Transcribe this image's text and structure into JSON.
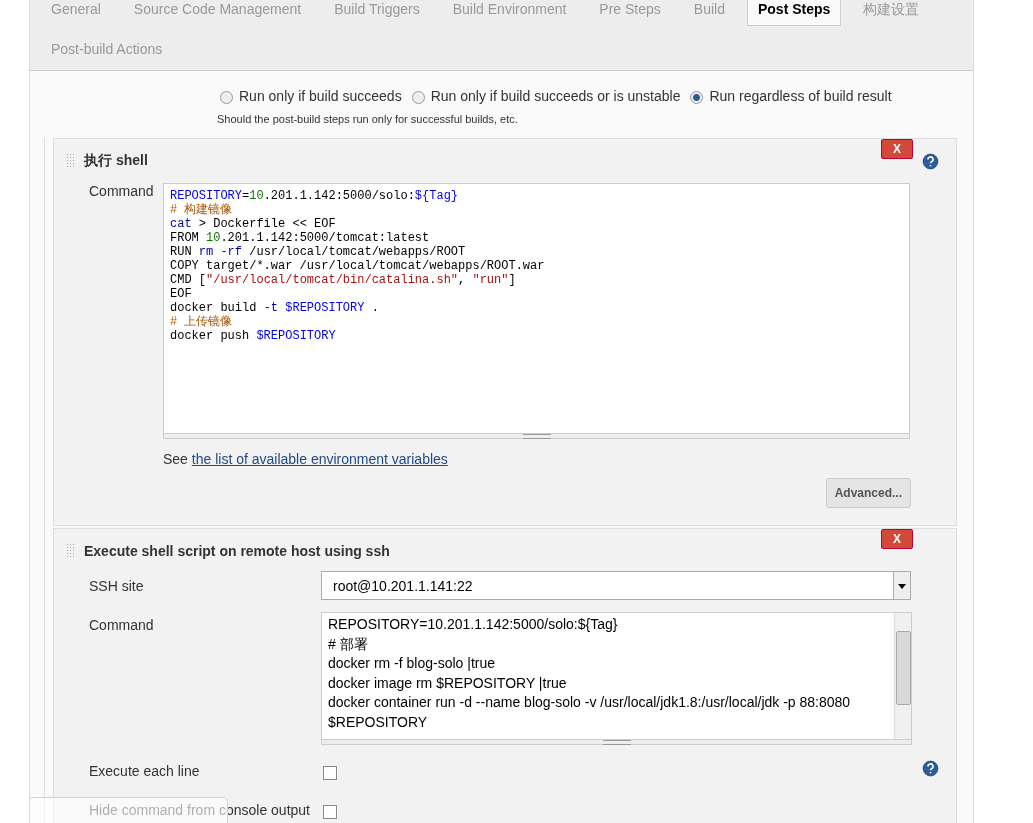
{
  "tabs": [
    {
      "label": "General",
      "selected": false
    },
    {
      "label": "Source Code Management",
      "selected": false
    },
    {
      "label": "Build Triggers",
      "selected": false
    },
    {
      "label": "Build Environment",
      "selected": false
    },
    {
      "label": "Pre Steps",
      "selected": false
    },
    {
      "label": "Build",
      "selected": false
    },
    {
      "label": "Post Steps",
      "selected": true
    },
    {
      "label": "构建设置",
      "selected": false
    },
    {
      "label": "Post-build Actions",
      "selected": false
    }
  ],
  "run_options": [
    {
      "label": "Run only if build succeeds",
      "selected": false
    },
    {
      "label": "Run only if build succeeds or is unstable",
      "selected": false
    },
    {
      "label": "Run regardless of build result",
      "selected": true
    }
  ],
  "run_hint": "Should the post-build steps run only for successful builds, etc.",
  "shell_step": {
    "title": "执行 shell",
    "delete": "X",
    "command_label": "Command",
    "command_lines": [
      [
        {
          "kind": "var",
          "text": "REPOSITORY"
        },
        {
          "kind": "plain",
          "text": "="
        },
        {
          "kind": "num",
          "text": "10"
        },
        {
          "kind": "plain",
          "text": ".201.1.142:5000/solo:"
        },
        {
          "kind": "var",
          "text": "${Tag}"
        }
      ],
      [
        {
          "kind": "comment",
          "text": "# 构建镜像"
        }
      ],
      [
        {
          "kind": "kw",
          "text": "cat"
        },
        {
          "kind": "plain",
          "text": " > Dockerfile << EOF"
        }
      ],
      [
        {
          "kind": "plain",
          "text": "FROM "
        },
        {
          "kind": "num",
          "text": "10"
        },
        {
          "kind": "plain",
          "text": ".201.1.142:5000/tomcat:latest"
        }
      ],
      [
        {
          "kind": "plain",
          "text": "RUN "
        },
        {
          "kind": "kw",
          "text": "rm -rf"
        },
        {
          "kind": "plain",
          "text": " /usr/local/tomcat/webapps/ROOT"
        }
      ],
      [
        {
          "kind": "plain",
          "text": "COPY target/*.war /usr/local/tomcat/webapps/ROOT.war"
        }
      ],
      [
        {
          "kind": "plain",
          "text": "CMD ["
        },
        {
          "kind": "str",
          "text": "\"/usr/local/tomcat/bin/catalina.sh\""
        },
        {
          "kind": "plain",
          "text": ", "
        },
        {
          "kind": "str",
          "text": "\"run\""
        },
        {
          "kind": "plain",
          "text": "]"
        }
      ],
      [
        {
          "kind": "plain",
          "text": "EOF"
        }
      ],
      [
        {
          "kind": "plain",
          "text": "docker build "
        },
        {
          "kind": "kw",
          "text": "-t "
        },
        {
          "kind": "var",
          "text": "$REPOSITORY"
        },
        {
          "kind": "plain",
          "text": " ."
        }
      ],
      [
        {
          "kind": "comment",
          "text": "# 上传镜像"
        }
      ],
      [
        {
          "kind": "plain",
          "text": "docker push "
        },
        {
          "kind": "var",
          "text": "$REPOSITORY"
        }
      ]
    ],
    "env_prefix": "See",
    "env_link": "the list of available environment variables",
    "advanced": "Advanced..."
  },
  "ssh_step": {
    "title": "Execute shell script on remote host using ssh",
    "delete": "X",
    "site_label": "SSH site",
    "site_value": "root@10.201.1.141:22",
    "command_label": "Command",
    "command_lines": [
      "REPOSITORY=10.201.1.142:5000/solo:${Tag}",
      "# 部署",
      "docker rm -f blog-solo |true",
      "docker image rm $REPOSITORY |true",
      "docker container run -d --name blog-solo -v /usr/local/jdk1.8:/usr/local/jdk -p 88:8080",
      "$REPOSITORY"
    ],
    "options": [
      {
        "label": "Execute each line",
        "checked": false
      },
      {
        "label": "Hide command from console output",
        "checked": false
      }
    ]
  }
}
